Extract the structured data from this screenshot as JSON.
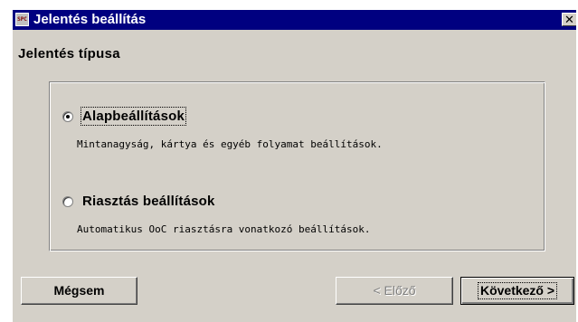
{
  "window": {
    "title": "Jelentés beállítás",
    "app_icon_text": "SPC",
    "close_glyph": "✕"
  },
  "heading": "Jelentés típusa",
  "options": [
    {
      "label": "Alapbeállítások",
      "description": "Mintanagyság, kártya és egyéb folyamat beállítások.",
      "selected": true
    },
    {
      "label": "Riasztás beállítások",
      "description": "Automatikus OoC riasztásra vonatkozó beállítások.",
      "selected": false
    }
  ],
  "buttons": {
    "cancel": "Mégsem",
    "previous": "< Előző",
    "next": "Következő >"
  },
  "icons": {
    "app": "spc-app-icon",
    "close": "close-icon",
    "radio_on": "radio-selected-icon",
    "radio_off": "radio-unselected-icon"
  }
}
